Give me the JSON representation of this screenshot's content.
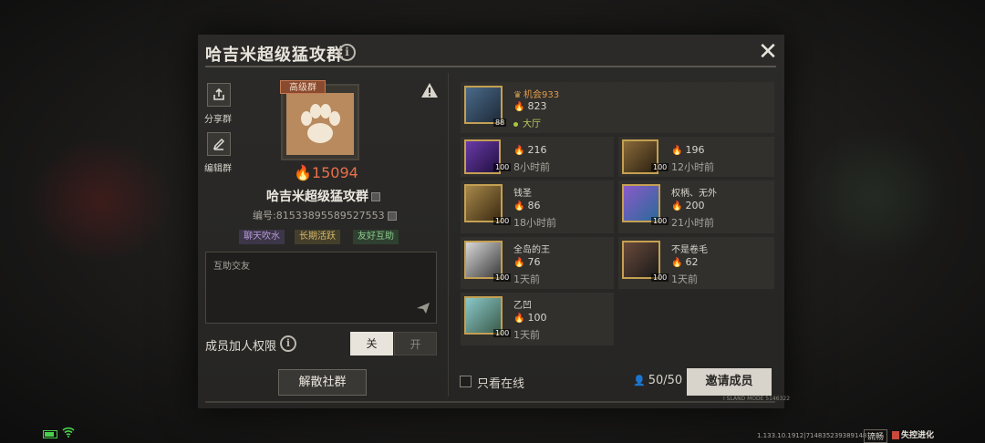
{
  "dialog": {
    "title": "哈吉米超级猛攻群",
    "close": "✕"
  },
  "sidebar": {
    "share_label": "分享群",
    "edit_label": "编辑群"
  },
  "group": {
    "rank_tag": "高级群",
    "heat": "15094",
    "name": "哈吉米超级猛攻群",
    "id_text": "编号:81533895589527553",
    "tags": [
      "聊天吹水",
      "长期活跃",
      "友好互助"
    ],
    "note": "互助交友"
  },
  "permission": {
    "label": "成员加人权限",
    "off_label": "关",
    "on_label": "开",
    "selected": "关"
  },
  "dissolve_label": "解散社群",
  "owner": {
    "name": "机会933",
    "heat": "823",
    "location": "大厅",
    "level": "88"
  },
  "members": [
    {
      "name": "",
      "heat": "216",
      "time": "8小时前",
      "level": "100"
    },
    {
      "name": "",
      "heat": "196",
      "time": "12小时前",
      "level": "100"
    },
    {
      "name": "钱圣",
      "heat": "86",
      "time": "18小时前",
      "level": "100"
    },
    {
      "name": "权柄、无外",
      "heat": "200",
      "time": "21小时前",
      "level": "100"
    },
    {
      "name": "全岛的王",
      "heat": "76",
      "time": "1天前",
      "level": "100"
    },
    {
      "name": "不是卷毛",
      "heat": "62",
      "time": "1天前",
      "level": "100"
    },
    {
      "name": "乙凹",
      "heat": "100",
      "time": "1天前",
      "level": "100"
    }
  ],
  "footer": {
    "online_only_label": "只看在线",
    "count": "50/50",
    "invite_label": "邀请成员",
    "island_code": "I SLAND MODE 5146322"
  },
  "status_bar": {
    "version": "1.133.10.1912|71483523938914817",
    "fluency": "流畅",
    "brand": "失控进化"
  },
  "colors": {
    "heat_orange": "#e8704a",
    "owner_gold": "#e09a4a",
    "online_green": "#a8c840",
    "invite_bg": "#d8d4cc"
  }
}
